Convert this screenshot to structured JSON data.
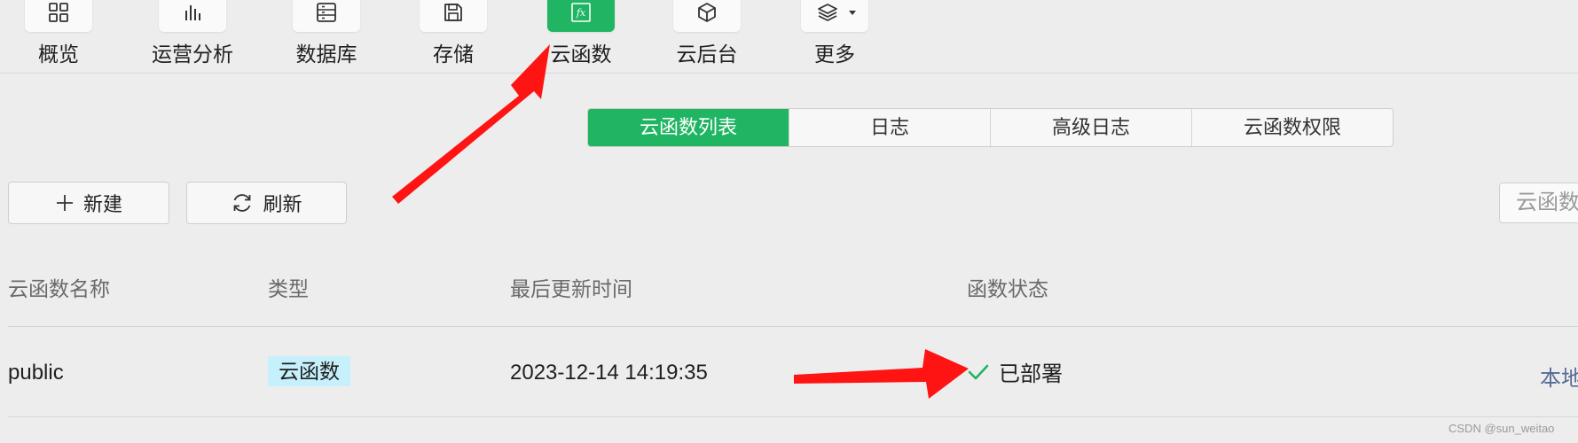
{
  "nav": {
    "items": [
      {
        "label": "概览",
        "icon": "grid-icon"
      },
      {
        "label": "运营分析",
        "icon": "bar-chart-icon"
      },
      {
        "label": "数据库",
        "icon": "database-icon"
      },
      {
        "label": "存储",
        "icon": "save-disk-icon"
      },
      {
        "label": "云函数",
        "icon": "fx-function-icon",
        "active": true
      },
      {
        "label": "云后台",
        "icon": "cube-icon"
      },
      {
        "label": "更多",
        "icon": "layers-icon"
      }
    ]
  },
  "tabs": [
    {
      "label": "云函数列表",
      "active": true
    },
    {
      "label": "日志"
    },
    {
      "label": "高级日志"
    },
    {
      "label": "云函数权限"
    }
  ],
  "toolbar": {
    "new_label": "新建",
    "refresh_label": "刷新",
    "search_placeholder": "云函数"
  },
  "table": {
    "headers": [
      "云函数名称",
      "类型",
      "最后更新时间",
      "函数状态"
    ],
    "rows": [
      {
        "name": "public",
        "type": "云函数",
        "updated": "2023-12-14 14:19:35",
        "status": "已部署",
        "action": "本地"
      }
    ]
  },
  "colors": {
    "accent": "#1fb562",
    "badge_bg": "#c6f0fb",
    "link": "#576b95",
    "annotation": "#ff1414"
  },
  "watermark": "CSDN @sun_weitao"
}
